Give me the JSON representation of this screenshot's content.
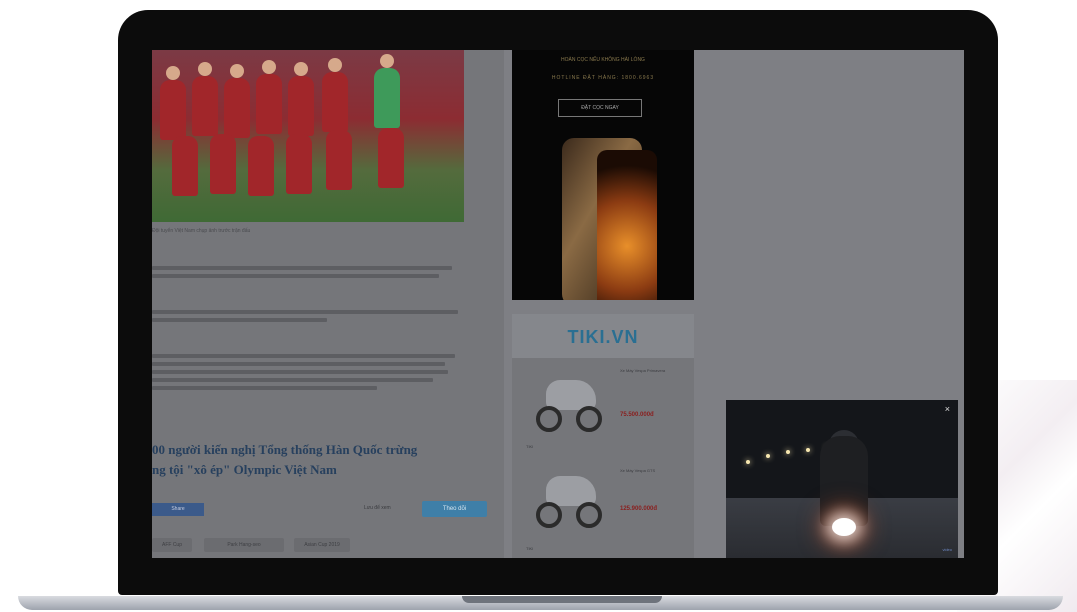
{
  "article": {
    "photo_caption": "Đội tuyển Việt Nam chụp ảnh trước trận đấu",
    "headline": "00 người kiến nghị Tổng thống Hàn Quốc trừng\nng tội \"xô ép\" Olympic Việt Nam",
    "share_label": "Share",
    "save_label": "Lưu để xem",
    "follow_label": "Theo dõi",
    "tags": [
      "AFF Cup",
      "Park Hang-seo",
      "Asian Cup 2019"
    ]
  },
  "ad_phone": {
    "line1": "HOÀN CỌC NẾU KHÔNG HÀI LÒNG",
    "line2": "HOTLINE ĐẶT HÀNG: 1800.6963",
    "cta": "ĐẶT CỌC NGAY"
  },
  "ad_tiki": {
    "logo": "TIKI.VN",
    "products": [
      {
        "name": "Xe Máy Vespa Primavera",
        "price": "75.500.000đ",
        "shop": "TIKI"
      },
      {
        "name": "Xe Máy Vespa GTS",
        "price": "125.900.000đ",
        "shop": "TIKI"
      }
    ]
  },
  "video": {
    "close": "×",
    "brand": "video"
  }
}
